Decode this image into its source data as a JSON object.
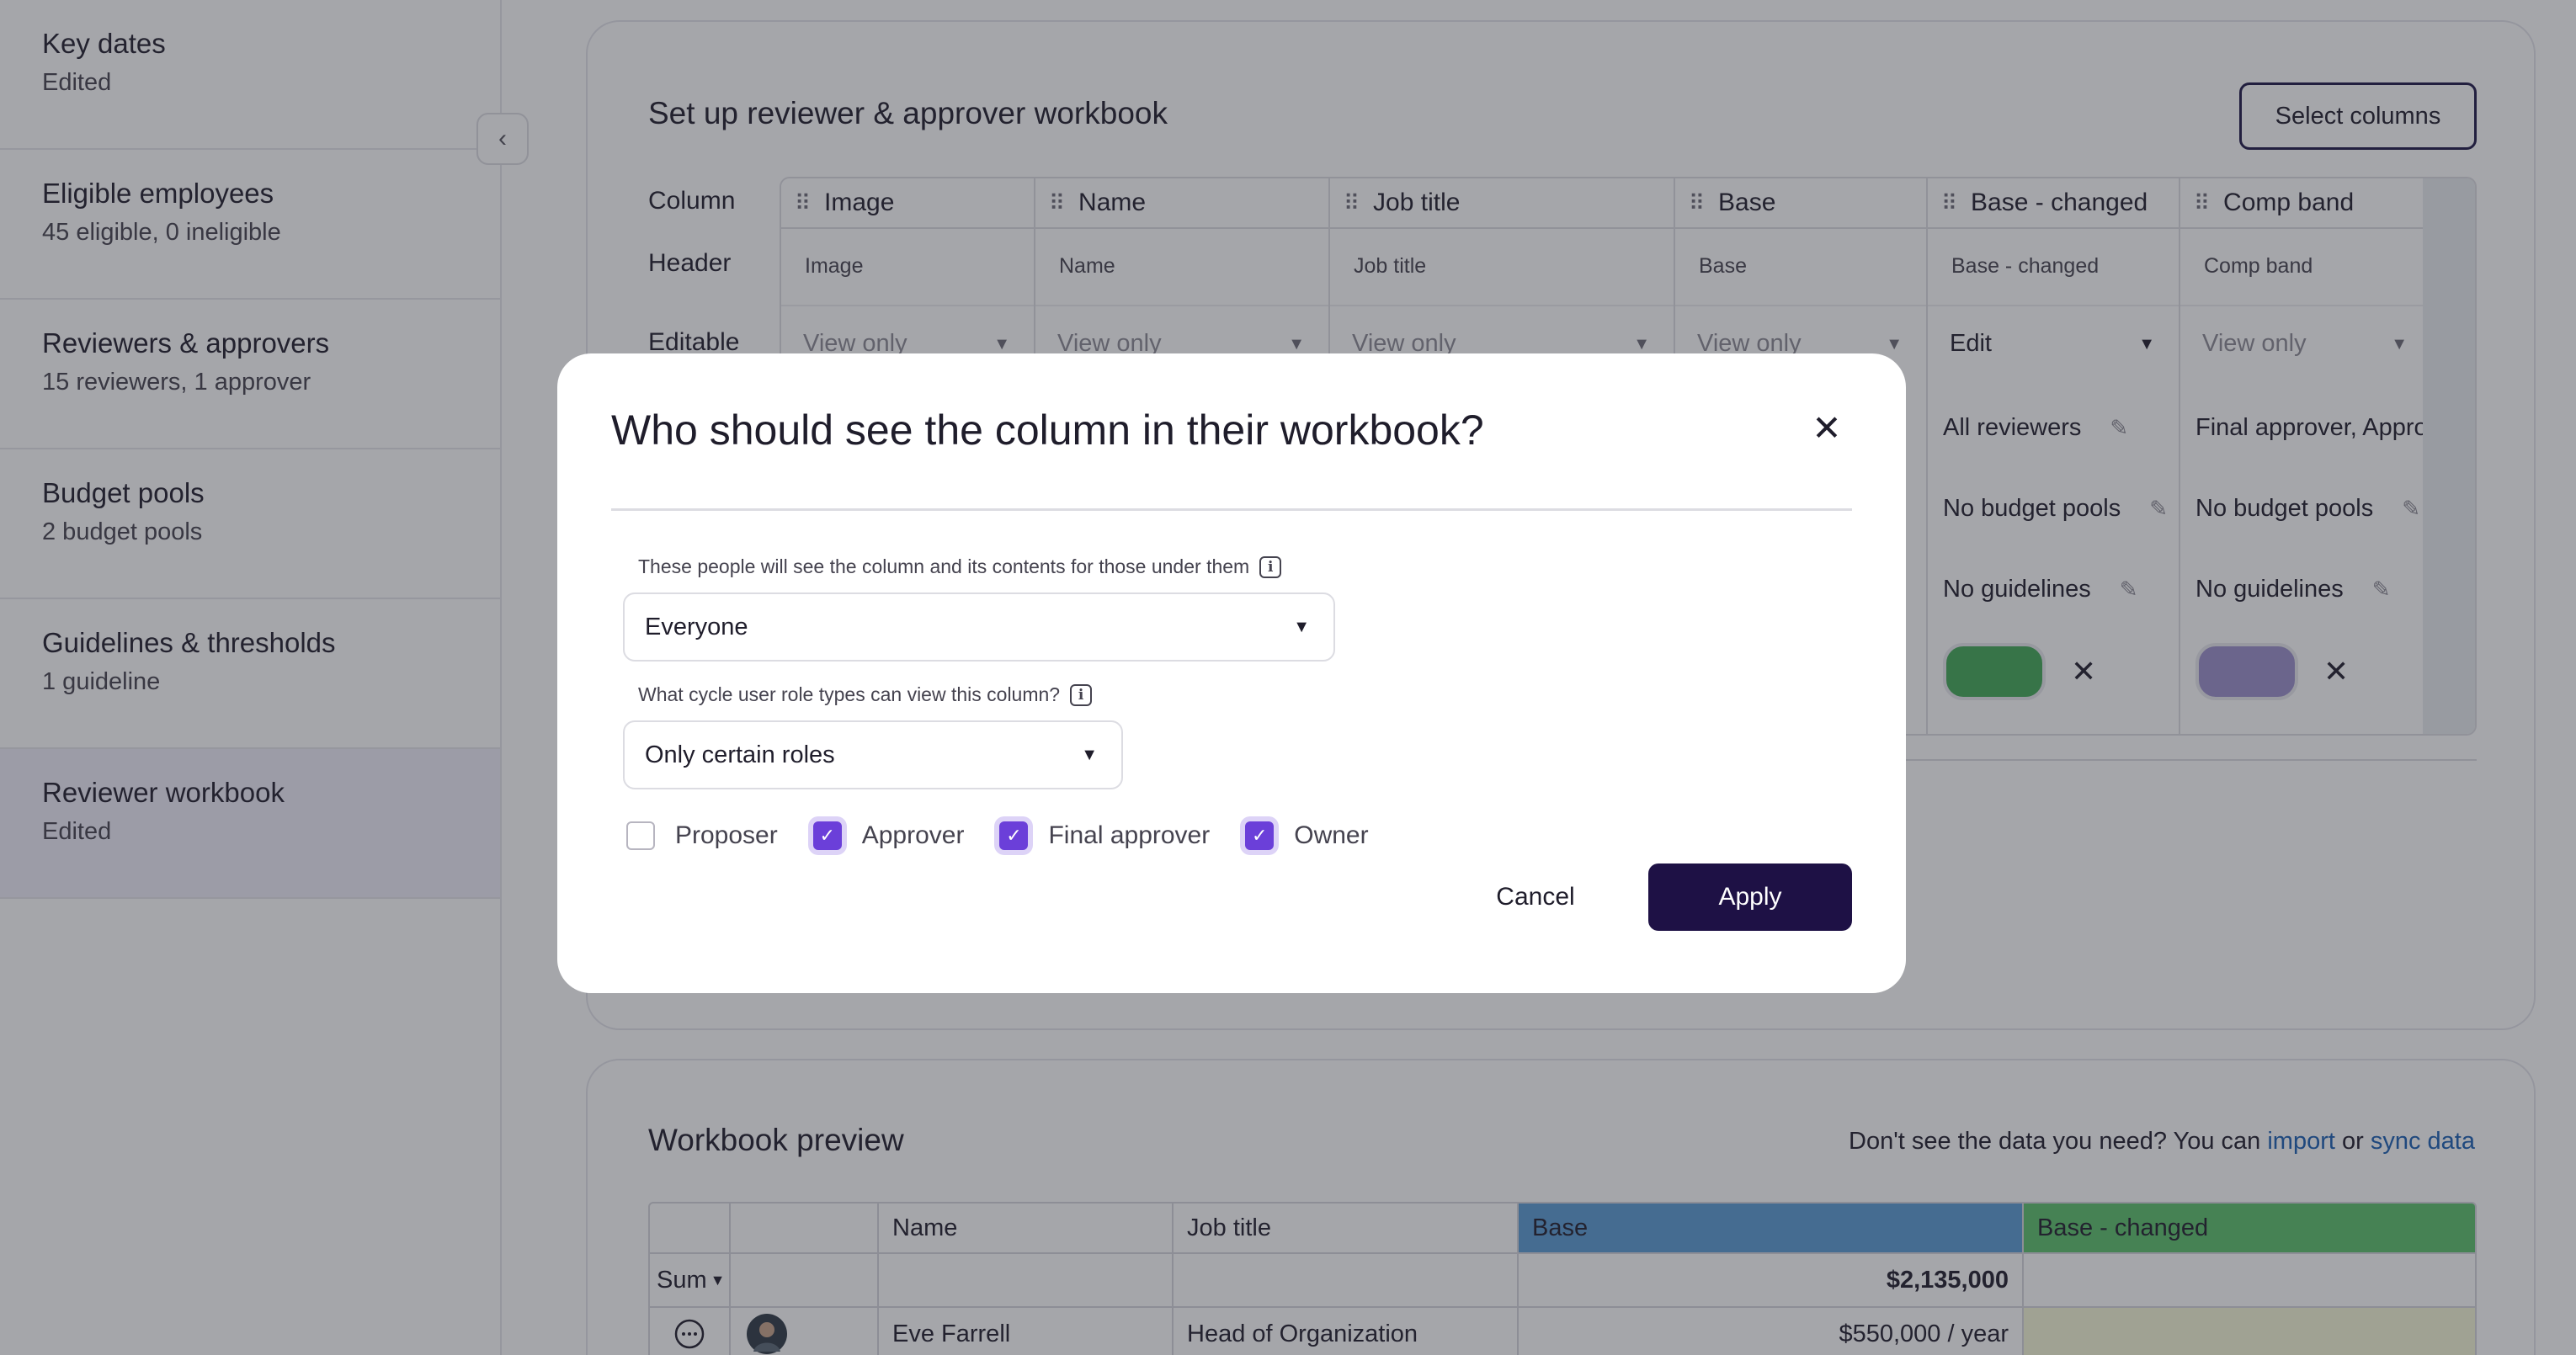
{
  "sidebar": {
    "items": [
      {
        "title": "Key dates",
        "subtitle": "Edited"
      },
      {
        "title": "Eligible employees",
        "subtitle": "45 eligible, 0 ineligible"
      },
      {
        "title": "Reviewers & approvers",
        "subtitle": "15 reviewers, 1 approver"
      },
      {
        "title": "Budget pools",
        "subtitle": "2 budget pools"
      },
      {
        "title": "Guidelines & thresholds",
        "subtitle": "1 guideline"
      },
      {
        "title": "Reviewer workbook",
        "subtitle": "Edited"
      }
    ],
    "collapse_icon": "‹"
  },
  "setup": {
    "title": "Set up reviewer & approver workbook",
    "select_columns_label": "Select columns",
    "row_labels": {
      "column": "Column",
      "header": "Header",
      "editable": "Editable"
    },
    "columns": [
      {
        "name": "Image",
        "header": "Image",
        "editable": "View only"
      },
      {
        "name": "Name",
        "header": "Name",
        "editable": "View only"
      },
      {
        "name": "Job title",
        "header": "Job title",
        "editable": "View only"
      },
      {
        "name": "Base",
        "header": "Base",
        "editable": "View only"
      },
      {
        "name": "Base - changed",
        "header": "Base - changed",
        "editable": "Edit",
        "visibility": "All reviewers",
        "budget": "No budget pools",
        "guidelines": "No guidelines",
        "color": "#43a957"
      },
      {
        "name": "Comp band",
        "header": "Comp band",
        "editable": "View only",
        "visibility": "Final approver, Approver",
        "budget": "No budget pools",
        "guidelines": "No guidelines",
        "color": "#9c8fcb"
      }
    ]
  },
  "preview": {
    "title": "Workbook preview",
    "note_prefix": "Don't see the data you need? You can",
    "import_link": "import",
    "or_text": "or",
    "sync_link": "sync data",
    "headers": {
      "name": "Name",
      "job_title": "Job title",
      "base": "Base",
      "base_changed": "Base - changed"
    },
    "header_colors": {
      "base": "#5b9bd5",
      "base_changed": "#5cc26b"
    },
    "sum_label": "Sum",
    "sum_value": "$2,135,000",
    "rows": [
      {
        "name": "Eve Farrell",
        "job_title": "Head of Organization",
        "base": "$550,000 / year"
      }
    ]
  },
  "modal": {
    "title": "Who should see the column in their workbook?",
    "people_label": "These people will see the column and its contents for those under them",
    "people_value": "Everyone",
    "roles_label": "What cycle user role types can view this column?",
    "roles_value": "Only certain roles",
    "roles": [
      {
        "label": "Proposer",
        "checked": false
      },
      {
        "label": "Approver",
        "checked": true
      },
      {
        "label": "Final approver",
        "checked": true
      },
      {
        "label": "Owner",
        "checked": true
      }
    ],
    "cancel_label": "Cancel",
    "apply_label": "Apply"
  }
}
